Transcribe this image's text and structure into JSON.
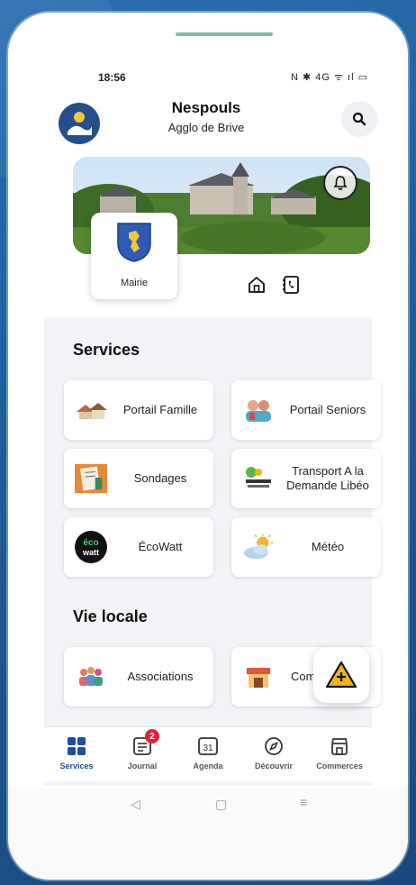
{
  "status": {
    "time": "18:56",
    "icons_text": "N ✱ 4G ᯤ ıl ▭"
  },
  "header": {
    "title": "Nespouls",
    "subtitle": "Agglo de Brive"
  },
  "mairie": {
    "label": "Mairie"
  },
  "services": {
    "title": "Services",
    "items": [
      {
        "label": "Portail Famille"
      },
      {
        "label": "Portail Seniors"
      },
      {
        "label": "Sondages"
      },
      {
        "label": "Transport A la Demande Libéo"
      },
      {
        "label": "ÉcoWatt"
      },
      {
        "label": "Météo"
      }
    ]
  },
  "vie_locale": {
    "title": "Vie locale",
    "items": [
      {
        "label": "Associations"
      },
      {
        "label": "Comi Entr"
      }
    ]
  },
  "nav": {
    "items": [
      {
        "label": "Services",
        "icon": "grid-icon"
      },
      {
        "label": "Journal",
        "icon": "newspaper-icon",
        "badge": "2"
      },
      {
        "label": "Agenda",
        "icon": "calendar-icon",
        "day": "31"
      },
      {
        "label": "Découvrir",
        "icon": "compass-icon"
      },
      {
        "label": "Commerces",
        "icon": "store-icon"
      }
    ]
  },
  "colors": {
    "accent": "#1f4f9a",
    "badge": "#e0213a",
    "fab": "#f2b31b",
    "background": "#1f5c97"
  }
}
